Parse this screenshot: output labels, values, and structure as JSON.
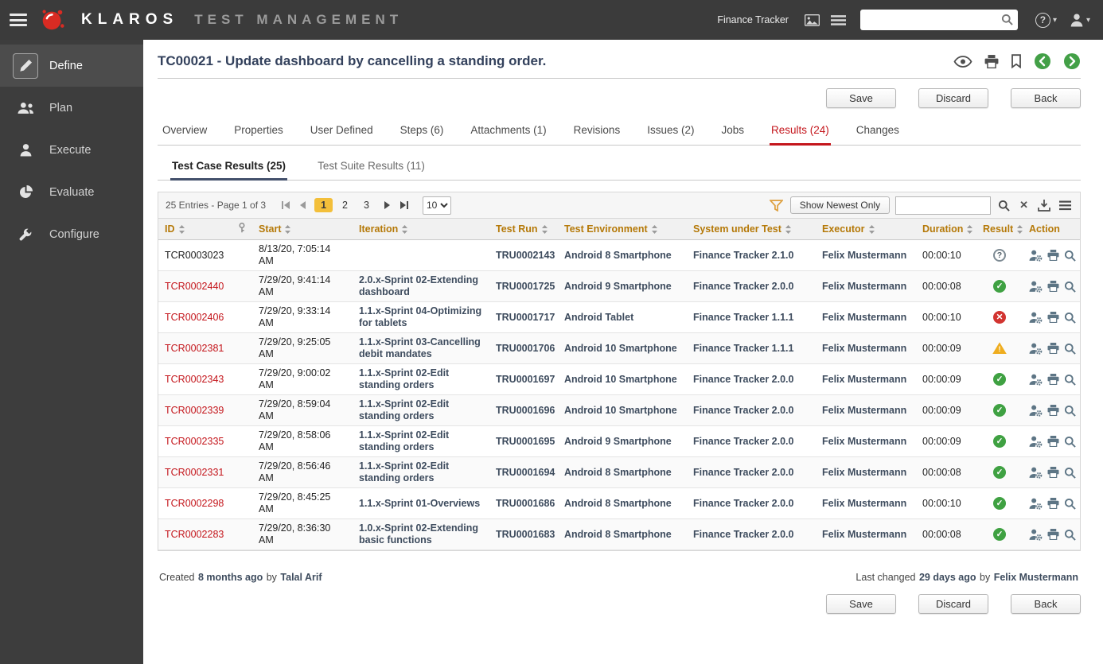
{
  "colors": {
    "accent_red": "#c4161c",
    "header_bg": "#3b3b3b",
    "sidebar_bg": "#3d3d3d",
    "success_green": "#3fa142",
    "error_red": "#d23430",
    "warning_amber": "#efad1f",
    "table_header_text": "#b57908",
    "page_highlight": "#f3bf3a",
    "nav_green": "#43a047",
    "link_dark": "#3e4c5e"
  },
  "header": {
    "brand_name": "KLAROS",
    "brand_suffix": "TEST MANAGEMENT",
    "project": "Finance Tracker",
    "search_value": "",
    "search_placeholder": ""
  },
  "sidebar": {
    "items": [
      {
        "label": "Define",
        "icon": "pencil",
        "active": true
      },
      {
        "label": "Plan",
        "icon": "users",
        "active": false
      },
      {
        "label": "Execute",
        "icon": "person",
        "active": false
      },
      {
        "label": "Evaluate",
        "icon": "pie",
        "active": false
      },
      {
        "label": "Configure",
        "icon": "wrench",
        "active": false
      }
    ]
  },
  "page": {
    "title": "TC00021 - Update dashboard by cancelling a standing order.",
    "buttons": {
      "save": "Save",
      "discard": "Discard",
      "back": "Back"
    },
    "tabs": [
      {
        "label": "Overview",
        "active": false
      },
      {
        "label": "Properties",
        "active": false
      },
      {
        "label": "User Defined",
        "active": false
      },
      {
        "label": "Steps (6)",
        "active": false
      },
      {
        "label": "Attachments (1)",
        "active": false
      },
      {
        "label": "Revisions",
        "active": false
      },
      {
        "label": "Issues (2)",
        "active": false
      },
      {
        "label": "Jobs",
        "active": false
      },
      {
        "label": "Results (24)",
        "active": true
      },
      {
        "label": "Changes",
        "active": false
      }
    ],
    "subtabs": [
      {
        "label": "Test Case Results (25)",
        "active": true
      },
      {
        "label": "Test Suite Results (11)",
        "active": false
      }
    ],
    "toolbar": {
      "entries_text": "25 Entries - Page 1 of 3",
      "pages": [
        "1",
        "2",
        "3"
      ],
      "current_page": "1",
      "page_size": "10",
      "show_newest_label": "Show Newest Only",
      "search_value": ""
    },
    "table": {
      "columns": [
        {
          "label": "ID",
          "sortable": true
        },
        {
          "label": "",
          "icon": "marker",
          "sortable": false
        },
        {
          "label": "Start",
          "sortable": true
        },
        {
          "label": "Iteration",
          "sortable": true
        },
        {
          "label": "Test Run",
          "sortable": true
        },
        {
          "label": "Test Environment",
          "sortable": true
        },
        {
          "label": "System under Test",
          "sortable": true
        },
        {
          "label": "Executor",
          "sortable": true
        },
        {
          "label": "Duration",
          "sortable": true
        },
        {
          "label": "Result",
          "sortable": true
        },
        {
          "label": "Action",
          "sortable": false
        }
      ],
      "rows": [
        {
          "id": "TCR0003023",
          "id_link": false,
          "start": "8/13/20, 7:05:14 AM",
          "iteration": "",
          "test_run": "TRU0002143",
          "environment": "Android 8 Smartphone",
          "sut": "Finance Tracker 2.1.0",
          "executor": "Felix Mustermann",
          "duration": "00:00:10",
          "result": "inconclusive"
        },
        {
          "id": "TCR0002440",
          "id_link": true,
          "start": "7/29/20, 9:41:14 AM",
          "iteration": "2.0.x-Sprint 02-Extending dashboard",
          "test_run": "TRU0001725",
          "environment": "Android 9 Smartphone",
          "sut": "Finance Tracker 2.0.0",
          "executor": "Felix Mustermann",
          "duration": "00:00:08",
          "result": "passed"
        },
        {
          "id": "TCR0002406",
          "id_link": true,
          "start": "7/29/20, 9:33:14 AM",
          "iteration": "1.1.x-Sprint 04-Optimizing for tablets",
          "test_run": "TRU0001717",
          "environment": "Android Tablet",
          "sut": "Finance Tracker 1.1.1",
          "executor": "Felix Mustermann",
          "duration": "00:00:10",
          "result": "failed"
        },
        {
          "id": "TCR0002381",
          "id_link": true,
          "start": "7/29/20, 9:25:05 AM",
          "iteration": "1.1.x-Sprint 03-Cancelling debit mandates",
          "test_run": "TRU0001706",
          "environment": "Android 10 Smartphone",
          "sut": "Finance Tracker 1.1.1",
          "executor": "Felix Mustermann",
          "duration": "00:00:09",
          "result": "warning"
        },
        {
          "id": "TCR0002343",
          "id_link": true,
          "start": "7/29/20, 9:00:02 AM",
          "iteration": "1.1.x-Sprint 02-Edit standing orders",
          "test_run": "TRU0001697",
          "environment": "Android 10 Smartphone",
          "sut": "Finance Tracker 2.0.0",
          "executor": "Felix Mustermann",
          "duration": "00:00:09",
          "result": "passed"
        },
        {
          "id": "TCR0002339",
          "id_link": true,
          "start": "7/29/20, 8:59:04 AM",
          "iteration": "1.1.x-Sprint 02-Edit standing orders",
          "test_run": "TRU0001696",
          "environment": "Android 10 Smartphone",
          "sut": "Finance Tracker 2.0.0",
          "executor": "Felix Mustermann",
          "duration": "00:00:09",
          "result": "passed"
        },
        {
          "id": "TCR0002335",
          "id_link": true,
          "start": "7/29/20, 8:58:06 AM",
          "iteration": "1.1.x-Sprint 02-Edit standing orders",
          "test_run": "TRU0001695",
          "environment": "Android 9 Smartphone",
          "sut": "Finance Tracker 2.0.0",
          "executor": "Felix Mustermann",
          "duration": "00:00:09",
          "result": "passed"
        },
        {
          "id": "TCR0002331",
          "id_link": true,
          "start": "7/29/20, 8:56:46 AM",
          "iteration": "1.1.x-Sprint 02-Edit standing orders",
          "test_run": "TRU0001694",
          "environment": "Android 8 Smartphone",
          "sut": "Finance Tracker 2.0.0",
          "executor": "Felix Mustermann",
          "duration": "00:00:08",
          "result": "passed"
        },
        {
          "id": "TCR0002298",
          "id_link": true,
          "start": "7/29/20, 8:45:25 AM",
          "iteration": "1.1.x-Sprint 01-Overviews",
          "test_run": "TRU0001686",
          "environment": "Android 8 Smartphone",
          "sut": "Finance Tracker 2.0.0",
          "executor": "Felix Mustermann",
          "duration": "00:00:10",
          "result": "passed"
        },
        {
          "id": "TCR0002283",
          "id_link": true,
          "start": "7/29/20, 8:36:30 AM",
          "iteration": "1.0.x-Sprint 02-Extending basic functions",
          "test_run": "TRU0001683",
          "environment": "Android 8 Smartphone",
          "sut": "Finance Tracker 2.0.0",
          "executor": "Felix Mustermann",
          "duration": "00:00:08",
          "result": "passed"
        }
      ]
    },
    "footer": {
      "created_label": "Created",
      "created_time": "8 months ago",
      "by_label": "by",
      "created_user": "Talal Arif",
      "changed_label": "Last changed",
      "changed_time": "29 days ago",
      "changed_user": "Felix Mustermann"
    }
  }
}
